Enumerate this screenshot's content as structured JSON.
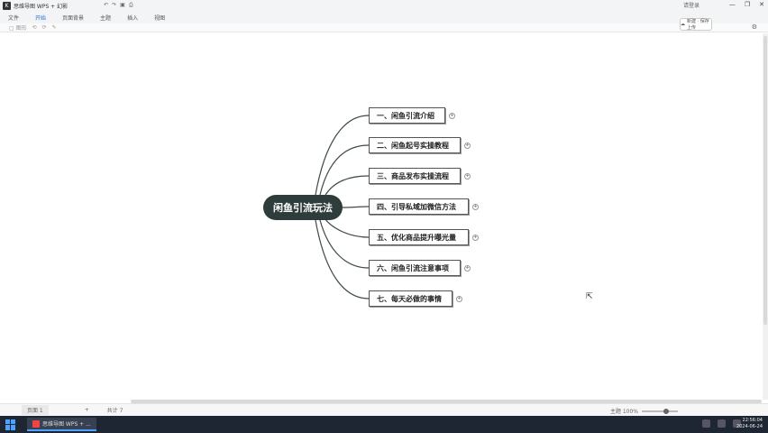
{
  "titlebar": {
    "doc_title": "思维导图 WPS + 幻影",
    "user_label": "请登录",
    "win_controls": [
      "—",
      "❐",
      "✕"
    ]
  },
  "menu": {
    "items": [
      "文件",
      "开始",
      "页面背景",
      "主题",
      "插入",
      "视图"
    ]
  },
  "toolbar": {
    "items": [
      "▢ 图形",
      "⟲",
      "⟳",
      "✎"
    ],
    "cloud_button": "新建 · 保存上传"
  },
  "mindmap": {
    "root": "闲鱼引流玩法",
    "children": [
      "一、闲鱼引流介绍",
      "二、闲鱼起号实操教程",
      "三、商品发布实操流程",
      "四、引导私域加微信方法",
      "五、优化商品提升曝光量",
      "六、闲鱼引流注意事项",
      "七、每天必做的事情"
    ]
  },
  "statusbar": {
    "sheet_tab": "页面 1",
    "add_sheet": "+",
    "word_count": "共计 7",
    "zoom_label": "主题 100%"
  },
  "taskbar": {
    "app_label": "思维导图 WPS + ...",
    "time": "22:56:04",
    "date": "2024-06-24"
  },
  "colors": {
    "root_bg": "#2e3d3b",
    "link": "#3d4a48",
    "taskbar_bg": "#1f2633"
  }
}
